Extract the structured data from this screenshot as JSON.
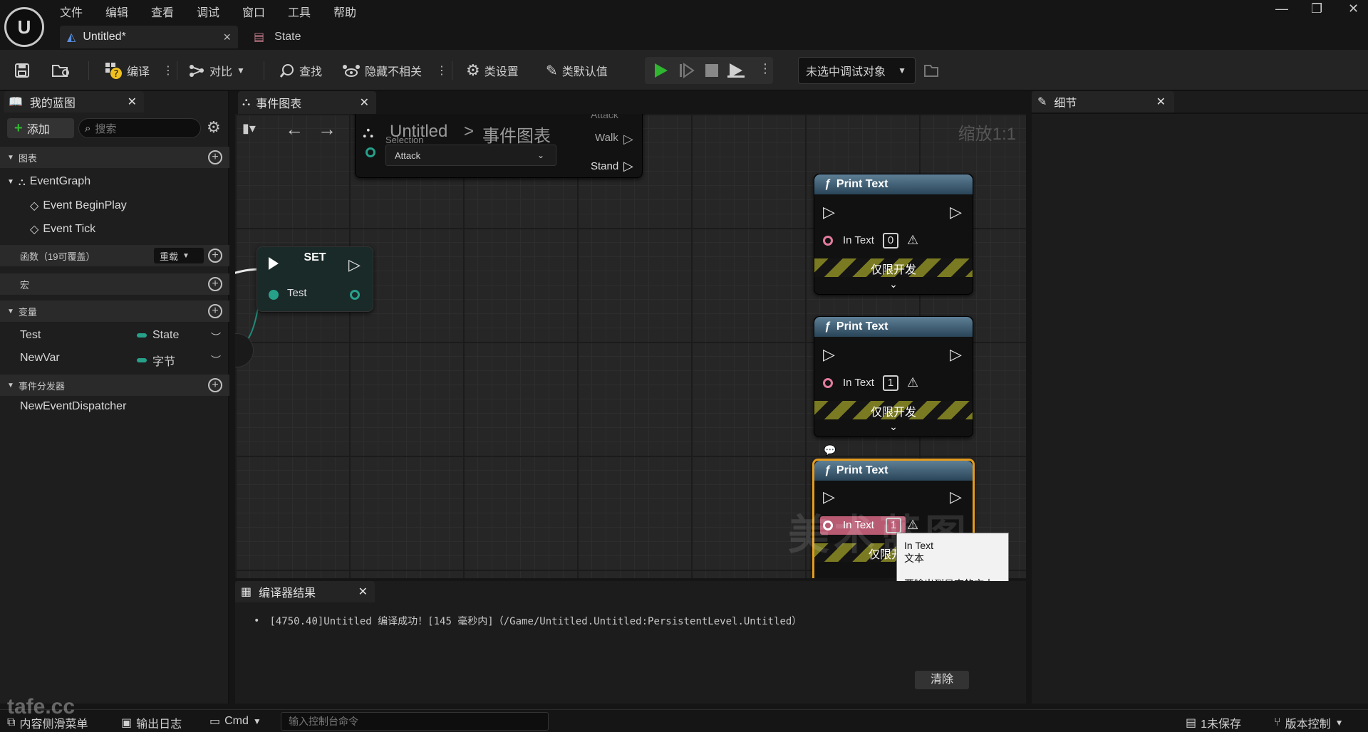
{
  "app": {
    "menu": [
      "文件",
      "编辑",
      "查看",
      "调试",
      "窗口",
      "工具",
      "帮助"
    ],
    "tabs": [
      {
        "label": "Untitled*",
        "close": "×"
      },
      {
        "label": "State"
      }
    ]
  },
  "toolbar": {
    "compile": "编译",
    "diff": "对比",
    "find": "查找",
    "hide_unrelated": "隐藏不相关",
    "class_settings": "类设置",
    "class_defaults": "类默认值",
    "debug_target": "未选中调试对象"
  },
  "left_panel": {
    "tab_title": "我的蓝图",
    "add_label": "添加",
    "search_placeholder": "搜索",
    "sections": {
      "graphs": "图表",
      "functions": "函数（19可覆盖）",
      "override_label": "重载",
      "macros": "宏",
      "variables": "变量",
      "dispatchers": "事件分发器"
    },
    "graph_items": [
      "EventGraph",
      "Event BeginPlay",
      "Event Tick"
    ],
    "variables": [
      {
        "name": "Test",
        "type": "State"
      },
      {
        "name": "NewVar",
        "type": "字节"
      }
    ],
    "dispatchers": [
      "NewEventDispatcher"
    ]
  },
  "graph": {
    "tab_title": "事件图表",
    "breadcrumb_root": "Untitled",
    "breadcrumb_sep": ">",
    "breadcrumb_leaf": "事件图表",
    "zoom": "缩放1:1",
    "switch_node": {
      "top_label": "Attack",
      "selection_label": "Selection",
      "selection_value": "Attack",
      "outputs": [
        "Walk",
        "Stand"
      ]
    },
    "set_node": {
      "title": "SET",
      "var": "Test"
    },
    "print_nodes": [
      {
        "title": "Print Text",
        "pin": "In Text",
        "value": "0",
        "dev": "仅限开发"
      },
      {
        "title": "Print Text",
        "pin": "In Text",
        "value": "1",
        "dev": "仅限开发"
      },
      {
        "title": "Print Text",
        "pin": "In Text",
        "value": "1",
        "dev": "仅限开发"
      }
    ],
    "tooltip": {
      "line1": "In Text",
      "line2": "文本",
      "line3": "要输出到日志的文本"
    },
    "watermark": "美术蓝图"
  },
  "details": {
    "tab_title": "细节"
  },
  "compiler": {
    "tab_title": "编译器结果",
    "message": "[4750.40]Untitled 编译成功！[145 毫秒内]（/Game/Untitled.Untitled:PersistentLevel.Untitled）",
    "clear_label": "清除"
  },
  "status_bar": {
    "content_drawer": "内容侧滑菜单",
    "output_log": "输出日志",
    "cmd": "Cmd",
    "console_placeholder": "输入控制台命令",
    "unsaved": "1未保存",
    "source_control": "版本控制"
  },
  "watermark_site": "tafe.cc",
  "colors": {
    "accent_green": "#2fb52f",
    "var_pill": "#27a08a",
    "pin_text": "#e27b9e",
    "selected_border": "#e59c1d"
  }
}
